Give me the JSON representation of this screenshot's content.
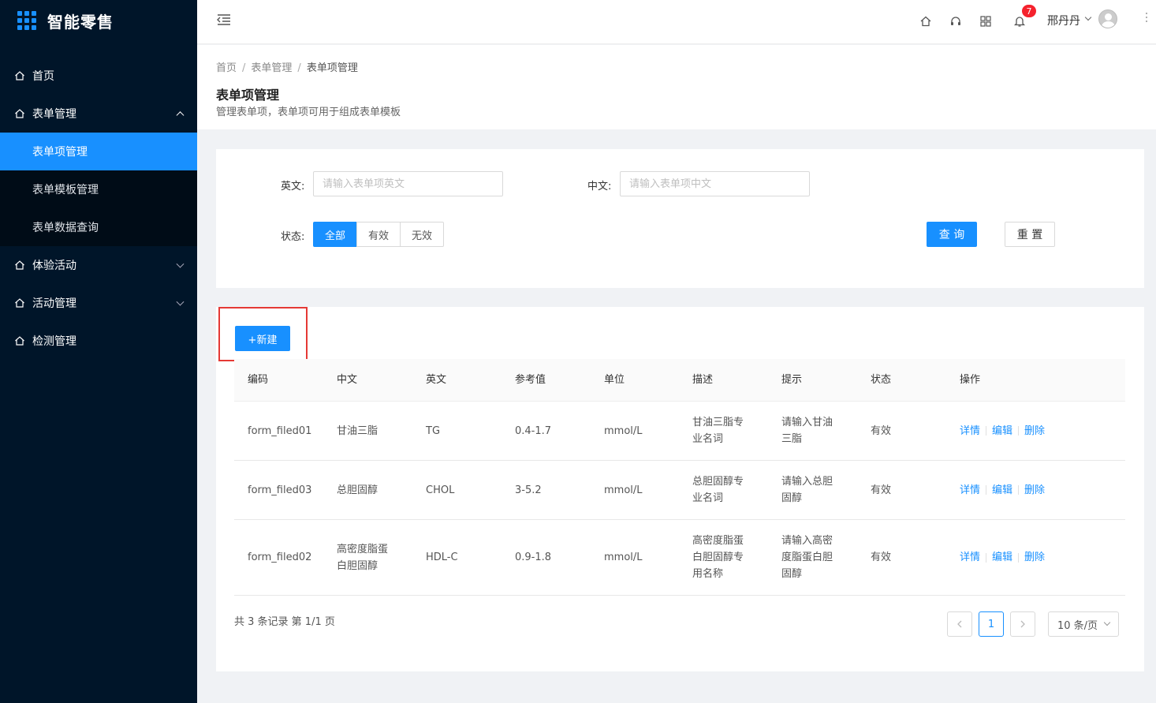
{
  "app": {
    "title": "智能零售"
  },
  "sidebar": {
    "items": [
      {
        "label": "首页"
      },
      {
        "label": "表单管理",
        "children": [
          {
            "label": "表单项管理",
            "active": true
          },
          {
            "label": "表单模板管理"
          },
          {
            "label": "表单数据查询"
          }
        ]
      },
      {
        "label": "体验活动"
      },
      {
        "label": "活动管理"
      },
      {
        "label": "检测管理"
      }
    ]
  },
  "header": {
    "notification_count": "7",
    "username": "邢丹丹"
  },
  "breadcrumb": [
    "首页",
    "表单管理",
    "表单项管理"
  ],
  "page": {
    "title": "表单项管理",
    "description": "管理表单项，表单项可用于组成表单模板"
  },
  "filters": {
    "english_label": "英文:",
    "english_placeholder": "请输入表单项英文",
    "chinese_label": "中文:",
    "chinese_placeholder": "请输入表单项中文",
    "status_label": "状态:",
    "status_options": [
      "全部",
      "有效",
      "无效"
    ],
    "status_selected": "全部",
    "query_button": "查 询",
    "reset_button": "重 置"
  },
  "table": {
    "new_button": "+新建",
    "columns": [
      "编码",
      "中文",
      "英文",
      "参考值",
      "单位",
      "描述",
      "提示",
      "状态",
      "操作"
    ],
    "rows": [
      {
        "code": "form_filed01",
        "chinese": "甘油三脂",
        "english": "TG",
        "reference": "0.4-1.7",
        "unit": "mmol/L",
        "description": "甘油三脂专业名词",
        "hint": "请输入甘油三脂",
        "status": "有效"
      },
      {
        "code": "form_filed03",
        "chinese": "总胆固醇",
        "english": "CHOL",
        "reference": "3-5.2",
        "unit": "mmol/L",
        "description": "总胆固醇专业名词",
        "hint": "请输入总胆固醇",
        "status": "有效"
      },
      {
        "code": "form_filed02",
        "chinese": "高密度脂蛋白胆固醇",
        "english": "HDL-C",
        "reference": "0.9-1.8",
        "unit": "mmol/L",
        "description": "高密度脂蛋白胆固醇专用名称",
        "hint": "请输入高密度脂蛋白胆固醇",
        "status": "有效"
      }
    ],
    "actions": [
      "详情",
      "编辑",
      "删除"
    ]
  },
  "pagination": {
    "summary": "共 3 条记录 第 1/1 页",
    "current_page": "1",
    "page_size": "10 条/页"
  },
  "colors": {
    "primary": "#1890ff",
    "sidebar_bg": "#001529",
    "highlight": "#e53935",
    "badge": "#f5222d"
  }
}
